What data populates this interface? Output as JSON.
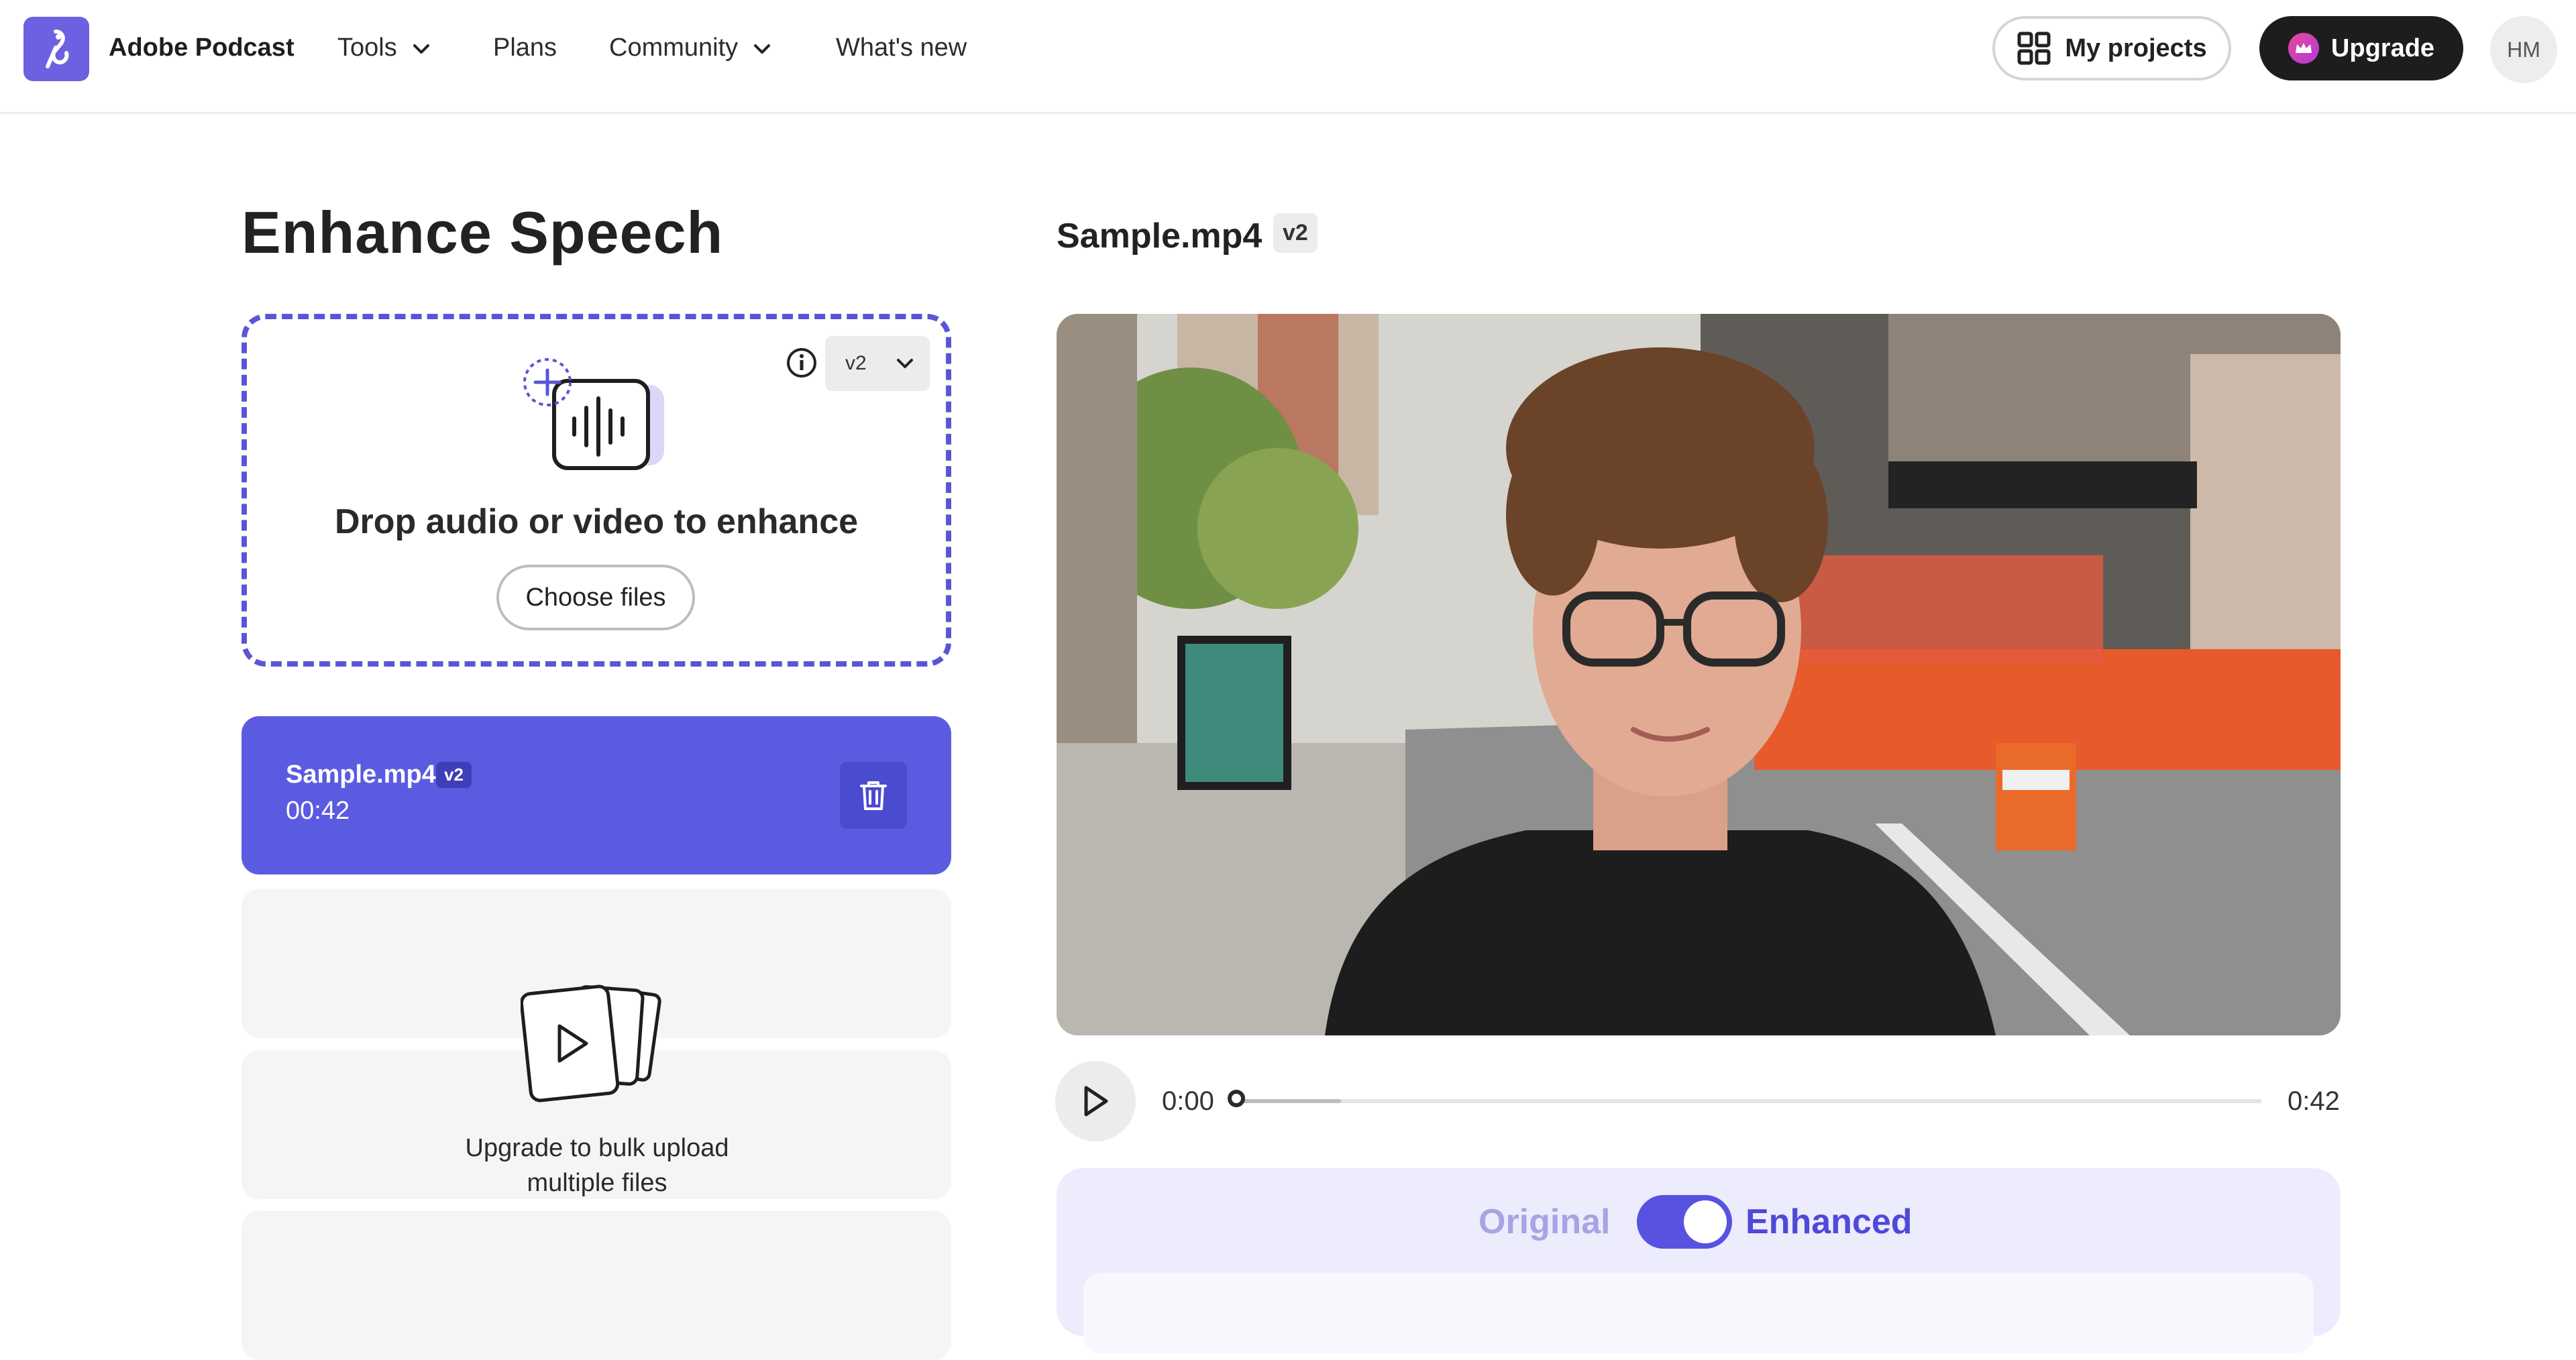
{
  "header": {
    "app_name": "Adobe Podcast",
    "nav": [
      {
        "label": "Tools",
        "has_dropdown": true
      },
      {
        "label": "Plans",
        "has_dropdown": false
      },
      {
        "label": "Community",
        "has_dropdown": true
      },
      {
        "label": "What's new",
        "has_dropdown": false
      }
    ],
    "my_projects_label": "My projects",
    "upgrade_label": "Upgrade",
    "avatar_initials": "HM"
  },
  "left": {
    "page_title": "Enhance Speech",
    "dropzone": {
      "version_selected": "v2",
      "title": "Drop audio or video to enhance",
      "choose_files_label": "Choose files"
    },
    "file": {
      "name": "Sample.mp4",
      "version": "v2",
      "duration": "00:42"
    },
    "bulk_upload_text_line1": "Upgrade to bulk upload",
    "bulk_upload_text_line2": "multiple files"
  },
  "right": {
    "file_title": "Sample.mp4",
    "version": "v2",
    "player": {
      "current_time": "0:00",
      "total_time": "0:42",
      "progress": 0,
      "buffered": 0.1
    },
    "compare": {
      "original_label": "Original",
      "enhanced_label": "Enhanced",
      "enhanced_on": true
    }
  },
  "colors": {
    "accent": "#5b5be2",
    "dropzone_border": "#5b55d6",
    "upgrade_bg": "#1d1d1d",
    "compare_bg": "#ececfc"
  }
}
